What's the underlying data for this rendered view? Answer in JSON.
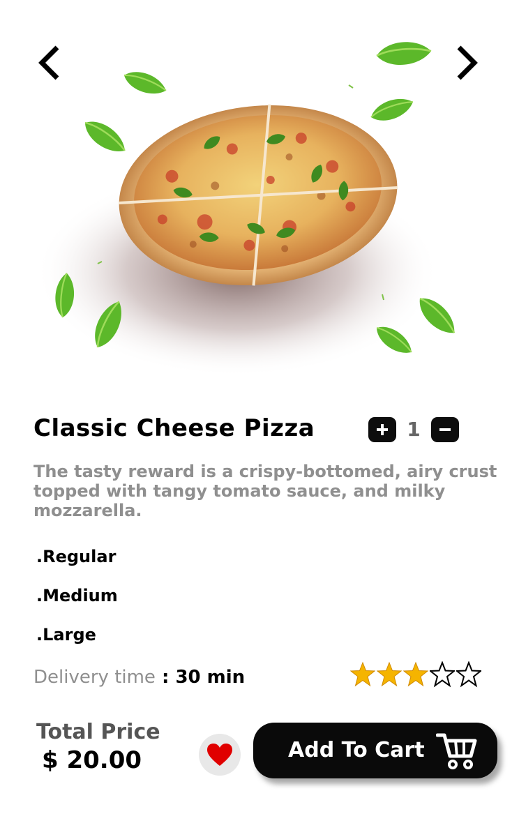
{
  "navigation": {
    "prev_icon": "chevron-left-icon",
    "next_icon": "chevron-right-icon"
  },
  "product": {
    "title": "Classic Cheese Pizza",
    "quantity": "1",
    "description": "The tasty reward is a crispy-bottomed, airy crust topped with tangy tomato sauce, and milky mozzarella.",
    "sizes": [
      ".Regular",
      ".Medium",
      ".Large"
    ],
    "delivery_label": "Delivery time",
    "delivery_value": " : 30 min",
    "rating": 3,
    "rating_max": 5
  },
  "footer": {
    "total_label": "Total Price",
    "total_price": "$ 20.00",
    "add_to_cart_label": "Add To Cart",
    "favorite_icon": "heart-icon",
    "cart_icon": "shopping-cart-icon"
  },
  "colors": {
    "accent": "#0d0d0d",
    "muted_text": "#8f8f8f",
    "heart": "#e00000",
    "star_fill": "#f5b400",
    "fav_bg": "#e8e8e8"
  }
}
